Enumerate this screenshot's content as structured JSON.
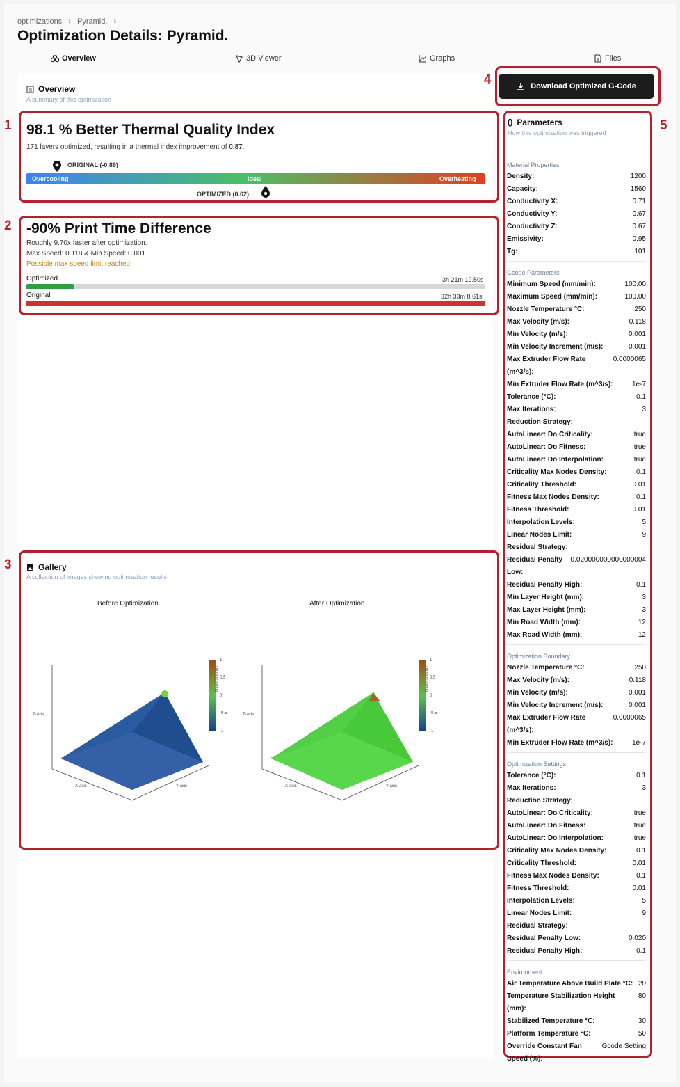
{
  "breadcrumb": {
    "items": [
      "optimizations",
      "Pyramid."
    ]
  },
  "title": "Optimization Details: Pyramid.",
  "tabs": [
    {
      "label": "Overview",
      "icon": "binoculars-icon"
    },
    {
      "label": "3D Viewer",
      "icon": "cube-icon"
    },
    {
      "label": "Graphs",
      "icon": "line-chart-icon"
    },
    {
      "label": "Files",
      "icon": "file-icon"
    }
  ],
  "overview": {
    "title": "Overview",
    "subtitle": "A summary of this optimization"
  },
  "download_button": {
    "label": "Download Optimized G-Code"
  },
  "annotations": {
    "n1": "1",
    "n2": "2",
    "n3": "3",
    "n4": "4",
    "n5": "5"
  },
  "thermal": {
    "headline": "98.1 % Better Thermal Quality Index",
    "desc_prefix": "171 layers optimized, resulting in a thermal index improvement of",
    "desc_value": "0.87",
    "desc_suffix": ".",
    "original_label": "ORIGINAL (-0.89)",
    "optimized_label": "OPTIMIZED (0.02)",
    "scale_left": "Overcooling",
    "scale_mid": "Ideal",
    "scale_right": "Overheating",
    "original_value": -0.89,
    "optimized_value": 0.02
  },
  "time": {
    "headline": "-90% Print Time Difference",
    "line1": "Roughly 9.70x faster after optimization.",
    "line2": "Max Speed: 0.118 & Min Speed: 0.001",
    "warning": "Possible max speed limit reached",
    "optimized_label": "Optimized",
    "optimized_time": "3h 21m 19.50s",
    "original_label": "Original",
    "original_time": "32h 33m 8.61s",
    "optimized_fraction": 0.103,
    "original_fraction": 1.0
  },
  "gallery": {
    "title": "Gallery",
    "subtitle": "A collection of images showing optimization results",
    "before_title": "Before Optimization",
    "after_title": "After Optimization",
    "z_axis": "Z-axis",
    "x_axis": "X-axis",
    "y_axis": "Y-axis",
    "colorbar_label": "Thermal Index",
    "ticks": [
      "1",
      "0.5",
      "0",
      "-0.5",
      "-1"
    ]
  },
  "parameters": {
    "title": "Parameters",
    "subtitle": "How this optimization was triggered",
    "sections": [
      {
        "name": "Material Properties",
        "rows": [
          [
            "Density:",
            "1200"
          ],
          [
            "Capacity:",
            "1560"
          ],
          [
            "Conductivity X:",
            "0.71"
          ],
          [
            "Conductivity Y:",
            "0.67"
          ],
          [
            "Conductivity Z:",
            "0.67"
          ],
          [
            "Emissivity:",
            "0.95"
          ],
          [
            "Tg:",
            "101"
          ]
        ]
      },
      {
        "name": "Gcode Parameters",
        "rows": [
          [
            "Minimum Speed (mm/min):",
            "100.00"
          ],
          [
            "Maximum Speed (mm/min):",
            "100.00"
          ],
          [
            "Nozzle Temperature °C:",
            "250"
          ],
          [
            "Max Velocity (m/s):",
            "0.118"
          ],
          [
            "Min Velocity (m/s):",
            "0.001"
          ],
          [
            "Min Velocity Increment (m/s):",
            "0.001"
          ],
          [
            "Max Extruder Flow Rate (m^3/s):",
            "0.0000065"
          ],
          [
            "Min Extruder Flow Rate (m^3/s):",
            "1e-7"
          ],
          [
            "Tolerance (°C):",
            "0.1"
          ],
          [
            "Max Iterations:",
            "3"
          ],
          [
            "Reduction Strategy:",
            ""
          ],
          [
            "AutoLinear: Do Criticality:",
            "true"
          ],
          [
            "AutoLinear: Do Fitness:",
            "true"
          ],
          [
            "AutoLinear: Do Interpolation:",
            "true"
          ],
          [
            "Criticality Max Nodes Density:",
            "0.1"
          ],
          [
            "Criticality Threshold:",
            "0.01"
          ],
          [
            "Fitness Max Nodes Density:",
            "0.1"
          ],
          [
            "Fitness Threshold:",
            "0.01"
          ],
          [
            "Interpolation Levels:",
            "5"
          ],
          [
            "Linear Nodes Limit:",
            "9"
          ],
          [
            "Residual Strategy:",
            ""
          ],
          [
            "Residual Penalty Low:",
            "0.020000000000000004"
          ],
          [
            "Residual Penalty High:",
            "0.1"
          ],
          [
            "Min Layer Height (mm):",
            "3"
          ],
          [
            "Max Layer Height (mm):",
            "3"
          ],
          [
            "Min Road Width (mm):",
            "12"
          ],
          [
            "Max Road Width (mm):",
            "12"
          ]
        ]
      },
      {
        "name": "Optimization Boundary",
        "rows": [
          [
            "Nozzle Temperature °C:",
            "250"
          ],
          [
            "Max Velocity (m/s):",
            "0.118"
          ],
          [
            "Min Velocity (m/s):",
            "0.001"
          ],
          [
            "Min Velocity Increment (m/s):",
            "0.001"
          ],
          [
            "Max Extruder Flow Rate (m^3/s):",
            "0.0000065"
          ],
          [
            "Min Extruder Flow Rate (m^3/s):",
            "1e-7"
          ]
        ]
      },
      {
        "name": "Optimization Settings",
        "rows": [
          [
            "Tolerance (°C):",
            "0.1"
          ],
          [
            "Max Iterations:",
            "3"
          ],
          [
            "Reduction Strategy:",
            ""
          ],
          [
            "AutoLinear: Do Criticality:",
            "true"
          ],
          [
            "AutoLinear: Do Fitness:",
            "true"
          ],
          [
            "AutoLinear: Do Interpolation:",
            "true"
          ],
          [
            "Criticality Max Nodes Density:",
            "0.1"
          ],
          [
            "Criticality Threshold:",
            "0.01"
          ],
          [
            "Fitness Max Nodes Density:",
            "0.1"
          ],
          [
            "Fitness Threshold:",
            "0.01"
          ],
          [
            "Interpolation Levels:",
            "5"
          ],
          [
            "Linear Nodes Limit:",
            "9"
          ],
          [
            "Residual Strategy:",
            ""
          ],
          [
            "Residual Penalty Low:",
            "0.020"
          ],
          [
            "Residual Penalty High:",
            "0.1"
          ]
        ]
      },
      {
        "name": "Environment",
        "rows": [
          [
            "Air Temperature Above Build Plate °C:",
            "20"
          ],
          [
            "Temperature Stabilization Height (mm):",
            "80"
          ],
          [
            "Stabilized Temperature °C:",
            "30"
          ],
          [
            "Platform Temperature °C:",
            "50"
          ],
          [
            "Override Constant Fan Speed (%):",
            "Gcode Setting"
          ]
        ]
      }
    ]
  },
  "colors": {
    "annotation": "#b5202e",
    "button": "#1c1c1c",
    "warning": "#c9850f",
    "optimized_bar": "#2ea043",
    "original_bar": "#d0322e"
  }
}
